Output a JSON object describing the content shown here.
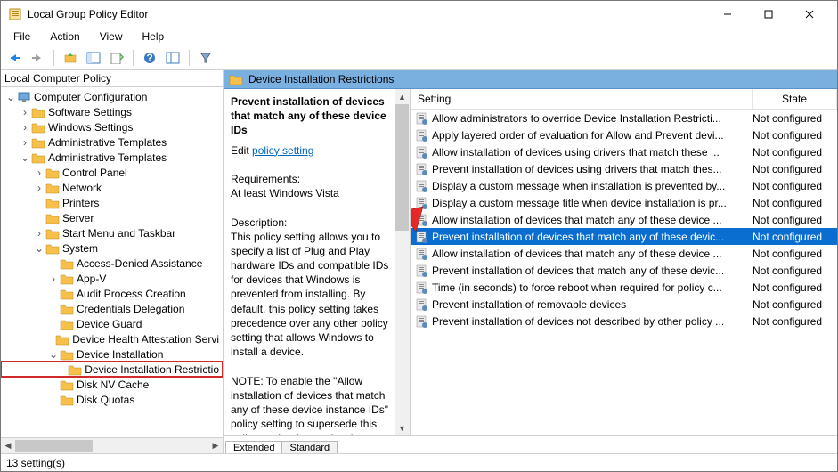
{
  "window": {
    "title": "Local Group Policy Editor"
  },
  "menubar": {
    "file": "File",
    "action": "Action",
    "view": "View",
    "help": "Help"
  },
  "tree": {
    "header": "Local Computer Policy",
    "computer_config": "Computer Configuration",
    "software_settings": "Software Settings",
    "windows_settings": "Windows Settings",
    "admin_templates_1": "Administrative Templates",
    "admin_templates_2": "Administrative Templates",
    "control_panel": "Control Panel",
    "network": "Network",
    "printers": "Printers",
    "server": "Server",
    "start_menu_taskbar": "Start Menu and Taskbar",
    "system": "System",
    "access_denied": "Access-Denied Assistance",
    "app_v": "App-V",
    "audit_process": "Audit Process Creation",
    "cred_delegation": "Credentials Delegation",
    "device_guard": "Device Guard",
    "device_health": "Device Health Attestation Servi",
    "device_install": "Device Installation",
    "device_install_restr": "Device Installation Restrictio",
    "disk_nv_cache": "Disk NV Cache",
    "disk_quotas": "Disk Quotas"
  },
  "desc": {
    "header": "Device Installation Restrictions",
    "setting_name": "Prevent installation of devices that match any of these device IDs",
    "edit_label": "Edit",
    "edit_link": "policy setting",
    "req_label": "Requirements:",
    "req_value": "At least Windows Vista",
    "desc_label": "Description:",
    "desc_text": "This policy setting allows you to specify a list of Plug and Play hardware IDs and compatible IDs for devices that Windows is prevented from installing. By default, this policy setting takes precedence over any other policy setting that allows Windows to install a device.",
    "note_text": "NOTE: To enable the \"Allow installation of devices that match any of these device instance IDs\" policy setting to supersede this policy setting for applicable"
  },
  "list": {
    "col_setting": "Setting",
    "col_state": "State",
    "state_nc": "Not configured",
    "rows": [
      {
        "label": "Allow administrators to override Device Installation Restricti...",
        "selected": false
      },
      {
        "label": "Apply layered order of evaluation for Allow and Prevent devi...",
        "selected": false
      },
      {
        "label": "Allow installation of devices using drivers that match these ...",
        "selected": false
      },
      {
        "label": "Prevent installation of devices using drivers that match thes...",
        "selected": false
      },
      {
        "label": "Display a custom message when installation is prevented by...",
        "selected": false
      },
      {
        "label": "Display a custom message title when device installation is pr...",
        "selected": false
      },
      {
        "label": "Allow installation of devices that match any of these device ...",
        "selected": false
      },
      {
        "label": "Prevent installation of devices that match any of these devic...",
        "selected": true
      },
      {
        "label": "Allow installation of devices that match any of these device ...",
        "selected": false
      },
      {
        "label": "Prevent installation of devices that match any of these devic...",
        "selected": false
      },
      {
        "label": "Time (in seconds) to force reboot when required for policy c...",
        "selected": false
      },
      {
        "label": "Prevent installation of removable devices",
        "selected": false
      },
      {
        "label": "Prevent installation of devices not described by other policy ...",
        "selected": false
      }
    ]
  },
  "tabs": {
    "extended": "Extended",
    "standard": "Standard"
  },
  "status": {
    "count": "13 setting(s)"
  }
}
